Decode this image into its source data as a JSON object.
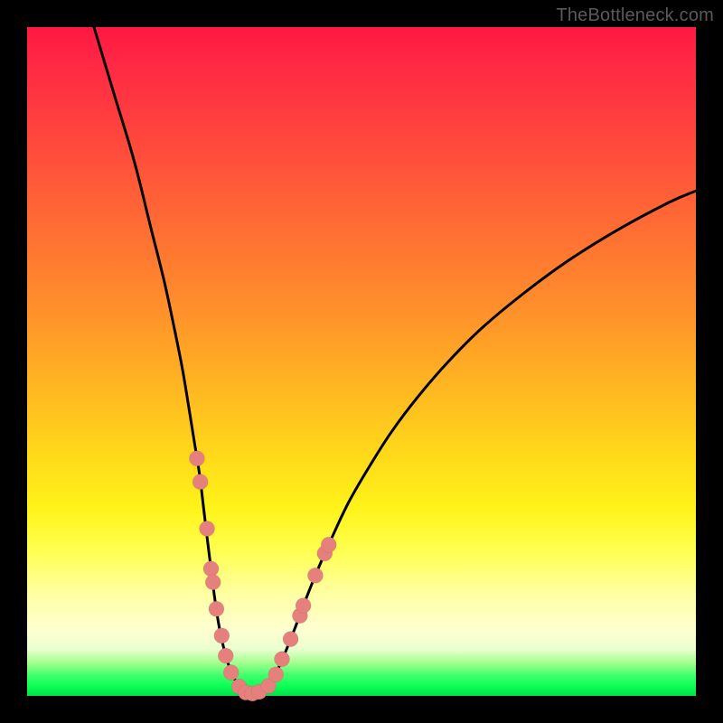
{
  "watermark": {
    "text": "TheBottleneck.com"
  },
  "chart_data": {
    "type": "line",
    "title": "",
    "xlabel": "",
    "ylabel": "",
    "xlim": [
      0,
      100
    ],
    "ylim": [
      0,
      100
    ],
    "curve": {
      "name": "bottleneck-curve",
      "points_xy": [
        [
          10,
          100
        ],
        [
          13,
          90
        ],
        [
          16,
          80
        ],
        [
          18.5,
          70
        ],
        [
          20.5,
          62
        ],
        [
          22,
          55
        ],
        [
          23.2,
          49
        ],
        [
          24.2,
          43
        ],
        [
          25,
          38
        ],
        [
          25.8,
          33
        ],
        [
          26.4,
          28
        ],
        [
          27,
          23
        ],
        [
          27.5,
          19
        ],
        [
          28,
          15
        ],
        [
          28.6,
          11
        ],
        [
          29.2,
          8
        ],
        [
          30,
          5
        ],
        [
          30.8,
          3
        ],
        [
          31.6,
          1.5
        ],
        [
          32.5,
          0.7
        ],
        [
          33.5,
          0.3
        ],
        [
          34.5,
          0.4
        ],
        [
          35.5,
          1
        ],
        [
          36.5,
          2.2
        ],
        [
          37.5,
          4
        ],
        [
          38.6,
          6.5
        ],
        [
          40,
          10
        ],
        [
          41.5,
          14
        ],
        [
          43.3,
          18.5
        ],
        [
          45.5,
          23.5
        ],
        [
          48,
          28.8
        ],
        [
          51,
          34
        ],
        [
          54.5,
          39.5
        ],
        [
          58.5,
          44.8
        ],
        [
          63,
          50
        ],
        [
          68,
          55
        ],
        [
          74,
          60
        ],
        [
          80.5,
          64.8
        ],
        [
          88,
          69.5
        ],
        [
          96,
          73.8
        ],
        [
          100,
          75.5
        ]
      ]
    },
    "dots": {
      "name": "highlighted-points",
      "color": "#e6807d",
      "radius": 8.5,
      "points_xy": [
        [
          25.4,
          35.5
        ],
        [
          25.9,
          32
        ],
        [
          26.9,
          25
        ],
        [
          27.5,
          19
        ],
        [
          27.8,
          17
        ],
        [
          28.3,
          13
        ],
        [
          29.1,
          9
        ],
        [
          29.7,
          6
        ],
        [
          30.5,
          3.5
        ],
        [
          31.7,
          1.4
        ],
        [
          32.7,
          0.5
        ],
        [
          33.7,
          0.35
        ],
        [
          34.7,
          0.6
        ],
        [
          36.1,
          1.5
        ],
        [
          37.2,
          3.2
        ],
        [
          38.1,
          5.5
        ],
        [
          39.4,
          8.5
        ],
        [
          40.8,
          12
        ],
        [
          41.3,
          13.5
        ],
        [
          43.1,
          18
        ],
        [
          44.5,
          21.3
        ],
        [
          45.1,
          22.6
        ]
      ]
    },
    "gradient_stops": [
      {
        "pos": 0,
        "color": "#ff1841"
      },
      {
        "pos": 50,
        "color": "#ffb721"
      },
      {
        "pos": 80,
        "color": "#ffff80"
      },
      {
        "pos": 100,
        "color": "#00e04a"
      }
    ]
  }
}
